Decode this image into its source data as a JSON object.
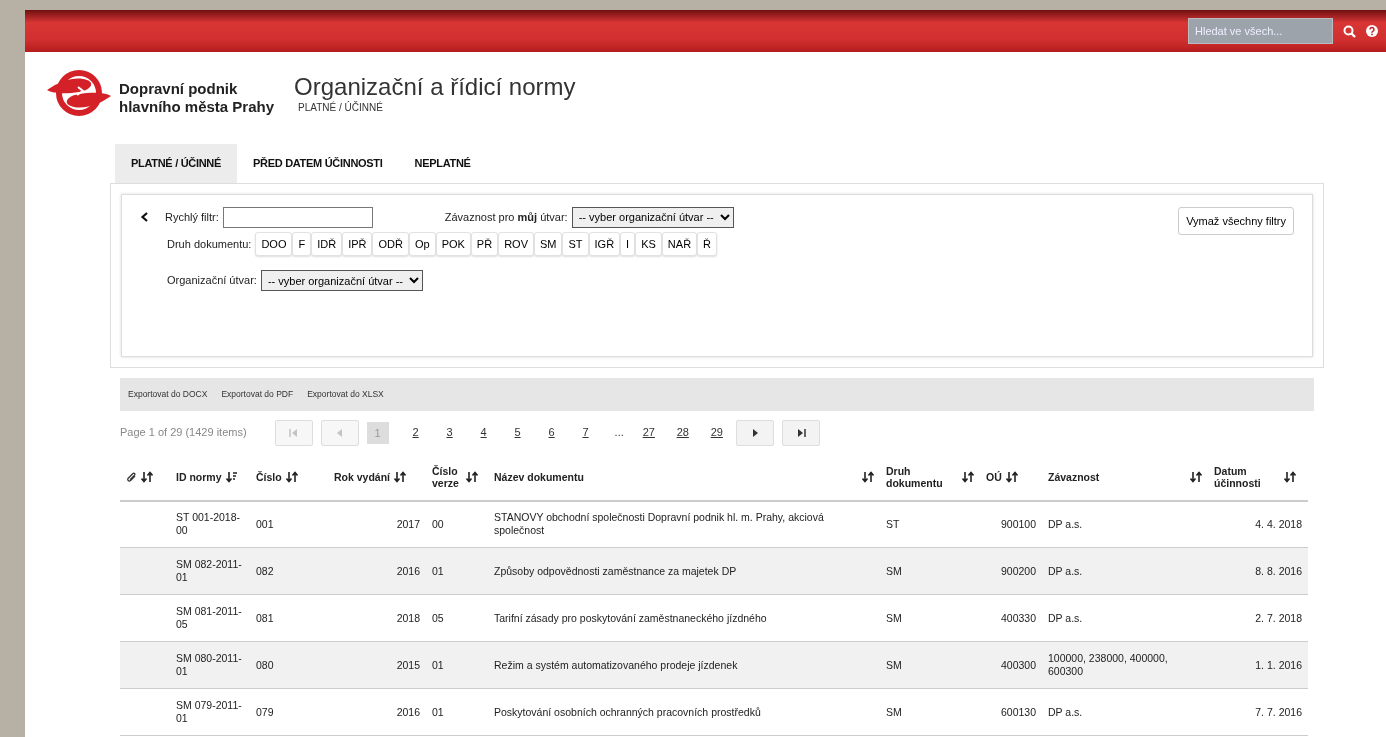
{
  "top_bar": {
    "search": {
      "placeholder": "Hledat ve všech..."
    }
  },
  "header": {
    "company": [
      "Dopravní podnik",
      "hlavního města Prahy"
    ],
    "title": "Organizační a řídicí normy",
    "subtitle": "PLATNÉ / ÚČINNÉ"
  },
  "tabs": [
    {
      "label": "PLATNÉ / ÚČINNÉ",
      "selected": true
    },
    {
      "label": "PŘED DATEM ÚČINNOSTI",
      "selected": false
    },
    {
      "label": "NEPLATNÉ",
      "selected": false
    }
  ],
  "filters": {
    "quick_filter_label": "Rychlý filtr:",
    "binding_label": "Závaznost pro **můj** útvar:",
    "binding_select": "-- vyber organizační útvar --",
    "doc_type_label": "Druh dokumentu:",
    "doc_types": [
      "DOO",
      "F",
      "IDŘ",
      "IPŘ",
      "ODŘ",
      "Op",
      "POK",
      "PŘ",
      "ROV",
      "SM",
      "ST",
      "IGŘ",
      "I",
      "KS",
      "NAŘ",
      "Ř"
    ],
    "unit_label": "Organizační útvar:",
    "unit_select": "-- vyber organizační útvar --",
    "clear_button": "Vymaž všechny filtry"
  },
  "exports": [
    "Exportovat do DOCX",
    "Exportovat do PDF",
    "Exportovat do XLSX"
  ],
  "pager": {
    "summary": "Page 1 of 29 (1429 items)",
    "items": [
      {
        "kind": "first",
        "disabled": true
      },
      {
        "kind": "prev",
        "disabled": true
      },
      {
        "kind": "page",
        "label": "1",
        "selected": true
      },
      {
        "kind": "page",
        "label": "2",
        "selected": false
      },
      {
        "kind": "page",
        "label": "3",
        "selected": false
      },
      {
        "kind": "page",
        "label": "4",
        "selected": false
      },
      {
        "kind": "page",
        "label": "5",
        "selected": false
      },
      {
        "kind": "page",
        "label": "6",
        "selected": false
      },
      {
        "kind": "page",
        "label": "7",
        "selected": false
      },
      {
        "kind": "ellipsis",
        "label": "..."
      },
      {
        "kind": "page",
        "label": "27",
        "selected": false
      },
      {
        "kind": "page",
        "label": "28",
        "selected": false
      },
      {
        "kind": "page",
        "label": "29",
        "selected": false
      },
      {
        "kind": "next",
        "disabled": false
      },
      {
        "kind": "last",
        "disabled": false
      }
    ]
  },
  "table": {
    "columns": [
      {
        "kind": "attachment",
        "sorted": false
      },
      {
        "kind": "text",
        "label": "ID normy",
        "sorted": true
      },
      {
        "kind": "text",
        "label": "Číslo",
        "sorted": false
      },
      {
        "kind": "text",
        "label": "Rok vydání",
        "sorted": false
      },
      {
        "kind": "text",
        "label": "Číslo verze",
        "sorted": false
      },
      {
        "kind": "text",
        "label": "Název dokumentu",
        "sorted": false
      },
      {
        "kind": "text",
        "label": "Druh dokumentu",
        "sorted": false
      },
      {
        "kind": "text",
        "label": "OÚ",
        "sorted": false
      },
      {
        "kind": "text",
        "label": "Závaznost",
        "sorted": false
      },
      {
        "kind": "text",
        "label": "Datum účinnosti",
        "sorted": false
      }
    ],
    "rows": [
      {
        "id": "ST 001-2018-00",
        "number": "001",
        "year": "2017",
        "version": "00",
        "name": "STANOVY obchodní společnosti Dopravní podnik hl. m. Prahy, akciová společnost",
        "type": "ST",
        "unit": "900100",
        "binding": "DP a.s.",
        "effective": "4. 4. 2018"
      },
      {
        "id": "SM 082-2011-01",
        "number": "082",
        "year": "2016",
        "version": "01",
        "name": "Způsoby odpovědnosti zaměstnance za majetek DP",
        "type": "SM",
        "unit": "900200",
        "binding": "DP a.s.",
        "effective": "8. 8. 2016"
      },
      {
        "id": "SM 081-2011-05",
        "number": "081",
        "year": "2018",
        "version": "05",
        "name": "Tarifní zásady pro poskytování zaměstnaneckého jízdného",
        "type": "SM",
        "unit": "400330",
        "binding": "DP a.s.",
        "effective": "2. 7. 2018"
      },
      {
        "id": "SM 080-2011-01",
        "number": "080",
        "year": "2015",
        "version": "01",
        "name": "Režim a systém automatizovaného prodeje jízdenek",
        "type": "SM",
        "unit": "400300",
        "binding": "100000, 238000, 400000, 600300",
        "effective": "1. 1. 2016"
      },
      {
        "id": "SM 079-2011-01",
        "number": "079",
        "year": "2016",
        "version": "01",
        "name": "Poskytování osobních ochranných pracovních prostředků",
        "type": "SM",
        "unit": "600130",
        "binding": "DP a.s.",
        "effective": "7. 7. 2016"
      }
    ]
  }
}
